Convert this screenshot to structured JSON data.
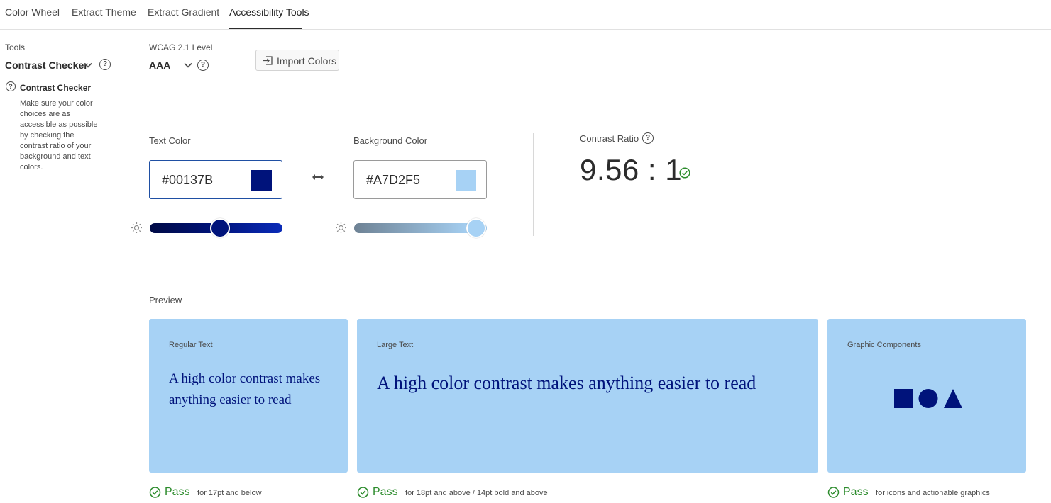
{
  "tabs": [
    {
      "label": "Color Wheel",
      "active": false
    },
    {
      "label": "Extract Theme",
      "active": false
    },
    {
      "label": "Extract Gradient",
      "active": false
    },
    {
      "label": "Accessibility Tools",
      "active": true
    }
  ],
  "sidebar": {
    "tools_label": "Tools",
    "tool_selected": "Contrast Checker",
    "help_title": "Contrast Checker",
    "help_text": "Make sure your color choices are as accessible as possible by checking the contrast ratio of your background and text colors."
  },
  "wcag": {
    "label": "WCAG 2.1 Level",
    "selected": "AAA"
  },
  "import_button": "Import Colors",
  "text_color": {
    "label": "Text Color",
    "value": "#00137B",
    "swatch": "#00137B",
    "slider_position": 0.53
  },
  "background_color": {
    "label": "Background Color",
    "value": "#A7D2F5",
    "swatch": "#A7D2F5",
    "slider_position": 0.92
  },
  "contrast": {
    "label": "Contrast Ratio",
    "value": "9.56 : 1"
  },
  "preview": {
    "label": "Preview",
    "cards": [
      {
        "caption": "Regular Text",
        "text": "A high color contrast makes anything easier to read"
      },
      {
        "caption": "Large Text",
        "text": "A high color contrast makes anything easier to read"
      },
      {
        "caption": "Graphic Components"
      }
    ],
    "results": [
      {
        "status": "Pass",
        "note": "for 17pt and below"
      },
      {
        "status": "Pass",
        "note": "for 18pt and above / 14pt bold and above"
      },
      {
        "status": "Pass",
        "note": "for icons and actionable graphics"
      }
    ]
  },
  "colors": {
    "text": "#00137B",
    "background": "#A7D2F5",
    "pass_green": "#2D8C2D",
    "focus_border": "#1F4FA3"
  },
  "icons": [
    "help-icon",
    "chevron-down-icon",
    "import-icon",
    "swap-icon",
    "brightness-icon",
    "check-circle-icon"
  ]
}
